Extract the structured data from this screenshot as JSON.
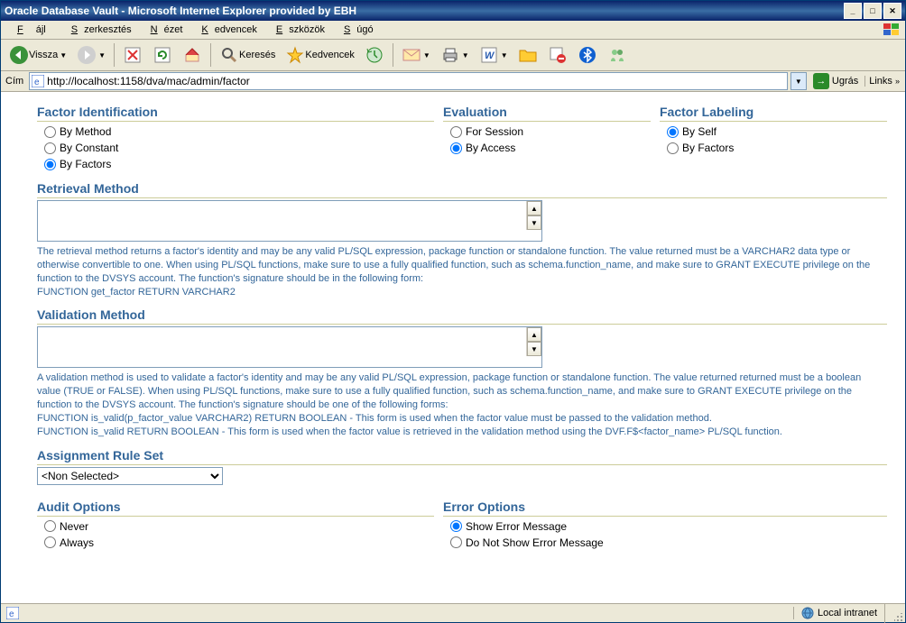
{
  "window": {
    "title": "Oracle Database Vault - Microsoft Internet Explorer provided by EBH"
  },
  "menu": {
    "file": "Fájl",
    "edit": "Szerkesztés",
    "view": "Nézet",
    "fav": "Kedvencek",
    "tools": "Eszközök",
    "help": "Súgó"
  },
  "toolbar": {
    "back": "Vissza",
    "search": "Keresés",
    "favorites": "Kedvencek"
  },
  "address": {
    "label": "Cím",
    "url": "http://localhost:1158/dva/mac/admin/factor",
    "go": "Ugrás",
    "links": "Links"
  },
  "sections": {
    "factor_identification": "Factor Identification",
    "evaluation": "Evaluation",
    "factor_labeling": "Factor Labeling",
    "retrieval_method": "Retrieval Method",
    "validation_method": "Validation Method",
    "assignment_rule_set": "Assignment Rule Set",
    "audit_options": "Audit Options",
    "error_options": "Error Options"
  },
  "factor_identification": {
    "opts": [
      "By Method",
      "By Constant",
      "By Factors"
    ]
  },
  "evaluation": {
    "opts": [
      "For Session",
      "By Access"
    ]
  },
  "factor_labeling": {
    "opts": [
      "By Self",
      "By Factors"
    ]
  },
  "retrieval_help": "The retrieval method returns a factor's identity and may be any valid PL/SQL expression, package function or standalone function. The value returned must be a VARCHAR2 data type or otherwise convertible to one. When using PL/SQL functions, make sure to use a fully qualified function, such as schema.function_name, and make sure to GRANT EXECUTE privilege on the function to the DVSYS account. The function's signature should be in the following form:",
  "retrieval_sig": "FUNCTION get_factor RETURN VARCHAR2",
  "validation_help": "A validation method is used to validate a factor's identity and may be any valid PL/SQL expression, package function or standalone function. The value returned returned must be a boolean value (TRUE or FALSE). When using PL/SQL functions, make sure to use a fully qualified function, such as schema.function_name, and make sure to GRANT EXECUTE privilege on the function to the DVSYS account. The function's signature should be one of the following forms:",
  "validation_sig1": "FUNCTION is_valid(p_factor_value VARCHAR2) RETURN BOOLEAN - This form is used when the factor value must be passed to the validation method.",
  "validation_sig2": "FUNCTION is_valid RETURN BOOLEAN - This form is used when the factor value is retrieved in the validation method using the DVF.F$<factor_name> PL/SQL function.",
  "rule_set": {
    "selected": "<Non Selected>"
  },
  "audit_options": {
    "opts": [
      "Never",
      "Always"
    ]
  },
  "error_options": {
    "opts": [
      "Show Error Message",
      "Do Not Show Error Message"
    ]
  },
  "status": {
    "zone": "Local intranet"
  }
}
